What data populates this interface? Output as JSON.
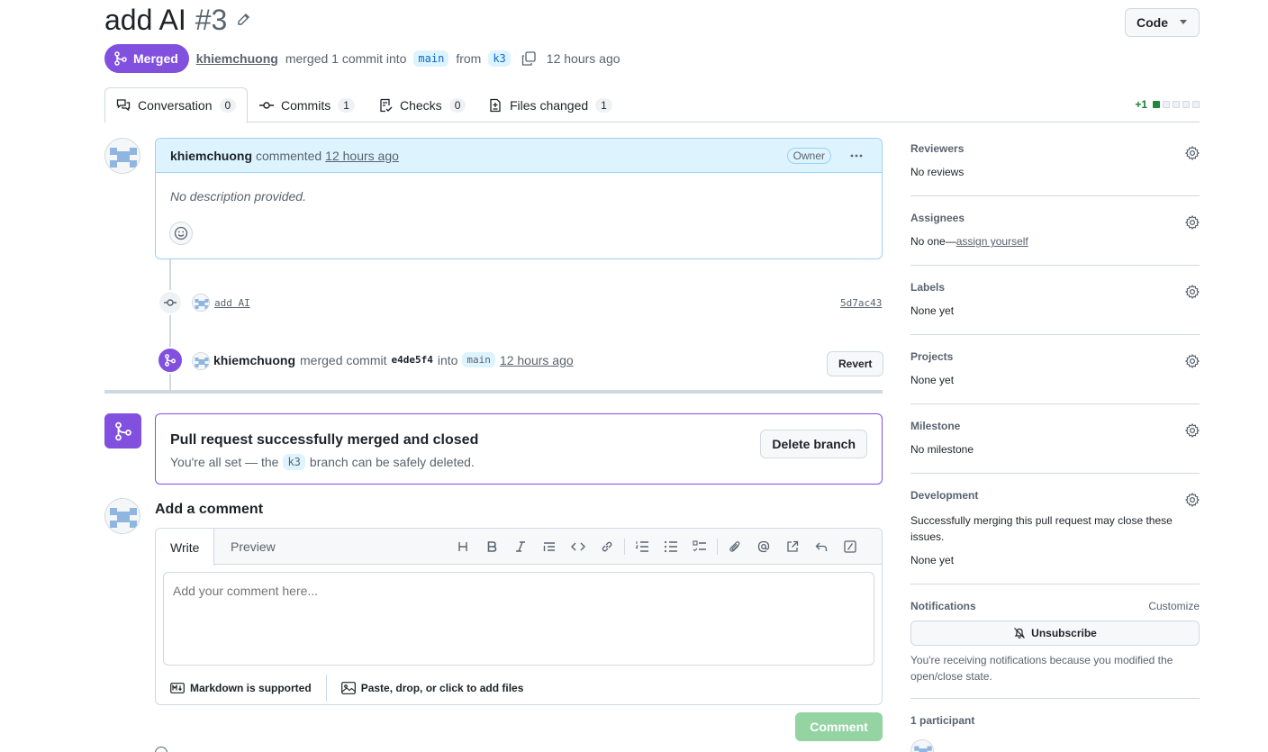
{
  "header": {
    "title": "add AI",
    "number": "#3",
    "code_button": "Code"
  },
  "meta": {
    "status": "Merged",
    "author": "khiemchuong",
    "action": "merged 1 commit into",
    "base_branch": "main",
    "from_word": "from",
    "head_branch": "k3",
    "time": "12 hours ago"
  },
  "tabs": [
    {
      "label": "Conversation",
      "count": "0"
    },
    {
      "label": "Commits",
      "count": "1"
    },
    {
      "label": "Checks",
      "count": "0"
    },
    {
      "label": "Files changed",
      "count": "1"
    }
  ],
  "diffstat": {
    "additions": "+1",
    "filled_boxes": 1,
    "total_boxes": 5
  },
  "comment": {
    "author": "khiemchuong",
    "verb": "commented",
    "time": "12 hours ago",
    "role": "Owner",
    "body": "No description provided."
  },
  "timeline": {
    "commit_message": "add AI",
    "commit_sha": "5d7ac43",
    "merge_author": "khiemchuong",
    "merge_text": "merged commit",
    "merge_sha": "e4de5f4",
    "into_word": "into",
    "merge_branch": "main",
    "merge_time": "12 hours ago",
    "revert_label": "Revert"
  },
  "merged_box": {
    "title": "Pull request successfully merged and closed",
    "sub_before": "You're all set — the",
    "branch": "k3",
    "sub_after": "branch can be safely deleted.",
    "delete_label": "Delete branch"
  },
  "add_comment": {
    "title": "Add a comment",
    "write_tab": "Write",
    "preview_tab": "Preview",
    "placeholder": "Add your comment here...",
    "markdown_note": "Markdown is supported",
    "attach_note": "Paste, drop, or click to add files",
    "submit_label": "Comment"
  },
  "sidebar": {
    "reviewers": {
      "heading": "Reviewers",
      "value": "No reviews"
    },
    "assignees": {
      "heading": "Assignees",
      "value_prefix": "No one—",
      "value_link": "assign yourself"
    },
    "labels": {
      "heading": "Labels",
      "value": "None yet"
    },
    "projects": {
      "heading": "Projects",
      "value": "None yet"
    },
    "milestone": {
      "heading": "Milestone",
      "value": "No milestone"
    },
    "development": {
      "heading": "Development",
      "note": "Successfully merging this pull request may close these issues.",
      "value": "None yet"
    },
    "notifications": {
      "heading": "Notifications",
      "customize": "Customize",
      "button": "Unsubscribe",
      "note": "You're receiving notifications because you modified the open/close state."
    },
    "participants": {
      "heading": "1 participant"
    }
  },
  "colors": {
    "merged": "#8250df",
    "link": "#0969da",
    "comment_btn_disabled": "#94d3a2",
    "diff_green": "#1f883d"
  }
}
